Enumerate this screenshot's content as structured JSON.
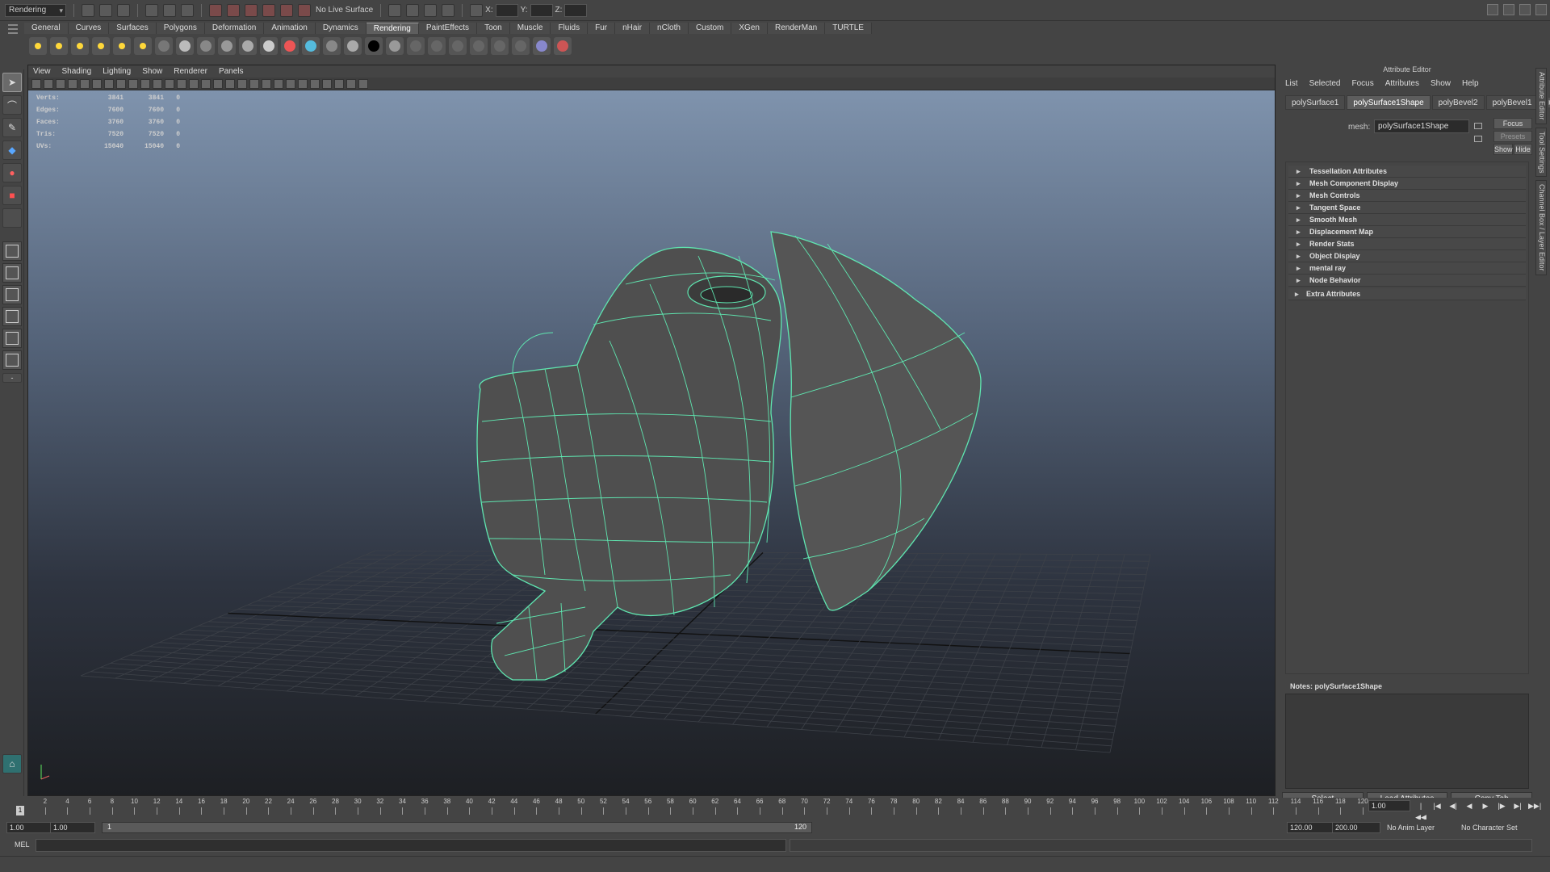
{
  "status_line": {
    "mode": "Rendering",
    "live_surface": "No Live Surface",
    "x_label": "X:",
    "y_label": "Y:",
    "z_label": "Z:"
  },
  "shelf": {
    "tabs": [
      "General",
      "Curves",
      "Surfaces",
      "Polygons",
      "Deformation",
      "Animation",
      "Dynamics",
      "Rendering",
      "PaintEffects",
      "Toon",
      "Muscle",
      "Fluids",
      "Fur",
      "nHair",
      "nCloth",
      "Custom",
      "XGen",
      "RenderMan",
      "TURTLE"
    ],
    "active_tab": "Rendering",
    "icons": [
      "point-light-icon",
      "spot-light-icon",
      "area-light-icon",
      "directional-light-icon",
      "ambient-light-icon",
      "volume-light-icon",
      "camera-icon",
      "blinn-icon",
      "lambert-icon",
      "phong-icon",
      "phongE-icon",
      "anisotropic-icon",
      "ramp-icon",
      "layered-icon",
      "surface-shader-icon",
      "use-background-icon",
      "black-sphere-icon",
      "grey-sphere-icon",
      "hypershade-icon",
      "render-view-icon",
      "render-settings-icon",
      "ipr-icon",
      "batch-render-icon",
      "render-layer-icon",
      "shader-ball-icon",
      "paint-icon"
    ]
  },
  "viewport": {
    "menu": [
      "View",
      "Shading",
      "Lighting",
      "Show",
      "Renderer",
      "Panels"
    ],
    "hud": [
      {
        "label": "Verts:",
        "a": "3841",
        "b": "3841",
        "c": "0"
      },
      {
        "label": "Edges:",
        "a": "7600",
        "b": "7600",
        "c": "0"
      },
      {
        "label": "Faces:",
        "a": "3760",
        "b": "3760",
        "c": "0"
      },
      {
        "label": "Tris:",
        "a": "7520",
        "b": "7520",
        "c": "0"
      },
      {
        "label": "UVs:",
        "a": "15040",
        "b": "15040",
        "c": "0"
      }
    ],
    "wire_color": "#5fe6b0"
  },
  "attribute_editor": {
    "title": "Attribute Editor",
    "menu": [
      "List",
      "Selected",
      "Focus",
      "Attributes",
      "Show",
      "Help"
    ],
    "tabs": [
      "polySurface1",
      "polySurface1Shape",
      "polyBevel2",
      "polyBevel1"
    ],
    "active_tab": "polySurface1Shape",
    "mesh_label": "mesh:",
    "mesh_value": "polySurface1Shape",
    "focus_btn": "Focus",
    "presets_btn": "Presets",
    "show_btn": "Show",
    "hide_btn": "Hide",
    "sections": [
      "Tessellation Attributes",
      "Mesh Component Display",
      "Mesh Controls",
      "Tangent Space",
      "Smooth Mesh",
      "Displacement Map",
      "Render Stats",
      "Object Display",
      "mental ray",
      "Node Behavior"
    ],
    "extra_section": "Extra Attributes",
    "notes_label": "Notes:  polySurface1Shape",
    "buttons": [
      "Select",
      "Load Attributes",
      "Copy Tab"
    ],
    "side_tabs": [
      "Attribute Editor",
      "Tool Settings",
      "Channel Box / Layer Editor"
    ]
  },
  "time_slider": {
    "ticks": [
      2,
      4,
      6,
      8,
      10,
      12,
      14,
      16,
      18,
      20,
      22,
      24,
      26,
      28,
      30,
      32,
      34,
      36,
      38,
      40,
      42,
      44,
      46,
      48,
      50,
      52,
      54,
      56,
      58,
      60,
      62,
      64,
      66,
      68,
      70,
      72,
      74,
      76,
      78,
      80,
      82,
      84,
      86,
      88,
      90,
      92,
      94,
      96,
      98,
      100,
      102,
      104,
      106,
      108,
      110,
      112,
      114,
      116,
      118,
      120
    ],
    "current_frame": "1",
    "current_time": "1.00"
  },
  "range_slider": {
    "start_time": "1.00",
    "playback_start": "1.00",
    "bar_start": "1",
    "bar_end": "120",
    "playback_end": "120.00",
    "end_time": "200.00",
    "anim_layer": "No Anim Layer",
    "character_set": "No Character Set"
  },
  "command_line": {
    "label": "MEL"
  }
}
